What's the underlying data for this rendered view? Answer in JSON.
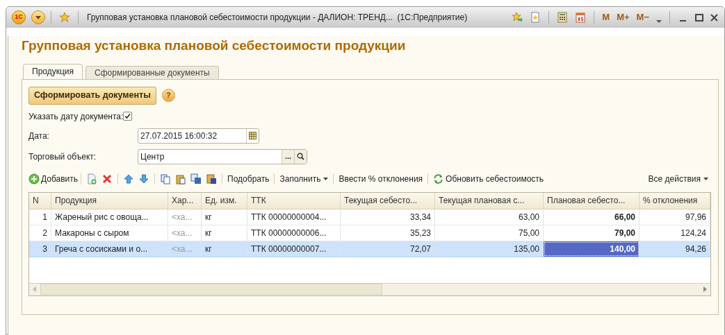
{
  "window": {
    "logo": "1С",
    "title": "Групповая установка плановой себестоимости продукции - ДАЛИОН: ТРЕНД...  (1С:Предприятие)",
    "memory_buttons": [
      "M",
      "M+",
      "M−"
    ]
  },
  "form_title": "Групповая установка плановой себестоимости продукции",
  "tabs": [
    {
      "label": "Продукция",
      "selected": true
    },
    {
      "label": "Сформированные документы",
      "selected": false
    }
  ],
  "primary_button": "Сформировать документы",
  "help_button": "?",
  "set_date": {
    "label": "Указать дату документа:",
    "checked": true
  },
  "date": {
    "label": "Дата:",
    "value": "27.07.2015 16:00:32"
  },
  "outlet": {
    "label": "Торговый объект:",
    "value": "Центр",
    "choose": "..."
  },
  "toolbar": {
    "add": "Добавить",
    "pick": "Подобрать",
    "fill": "Заполнить",
    "deviation": "Ввести % отклонения",
    "refresh": "Обновить себестоимость",
    "all_actions": "Все действия"
  },
  "table": {
    "columns": [
      {
        "title": "N",
        "kind": "number"
      },
      {
        "title": "Продукция",
        "kind": "text"
      },
      {
        "title": "Хар...",
        "kind": "muted"
      },
      {
        "title": "Ед. изм.",
        "kind": "text"
      },
      {
        "title": "ТТК",
        "kind": "text"
      },
      {
        "title": "Текущая себесто...",
        "kind": "number"
      },
      {
        "title": "Текущая плановая с...",
        "kind": "number"
      },
      {
        "title": "Плановая себесто...",
        "kind": "bold"
      },
      {
        "title": "% отклонения",
        "kind": "number"
      }
    ],
    "rows": [
      {
        "selected": false,
        "cells": [
          {
            "text": "1",
            "focused": false
          },
          {
            "text": "Жареный рис с овоща...",
            "focused": false
          },
          {
            "text": "<ха...",
            "focused": false
          },
          {
            "text": "кг",
            "focused": false
          },
          {
            "text": "ТТК 00000000004...",
            "focused": false
          },
          {
            "text": "33,34",
            "focused": false
          },
          {
            "text": "63,00",
            "focused": false
          },
          {
            "text": "66,00",
            "focused": false
          },
          {
            "text": "97,96",
            "focused": false
          }
        ]
      },
      {
        "selected": false,
        "cells": [
          {
            "text": "2",
            "focused": false
          },
          {
            "text": "Макароны с сыром",
            "focused": false
          },
          {
            "text": "<ха...",
            "focused": false
          },
          {
            "text": "кг",
            "focused": false
          },
          {
            "text": "ТТК 00000000006...",
            "focused": false
          },
          {
            "text": "35,23",
            "focused": false
          },
          {
            "text": "75,00",
            "focused": false
          },
          {
            "text": "79,00",
            "focused": false
          },
          {
            "text": "124,24",
            "focused": false
          }
        ]
      },
      {
        "selected": true,
        "cells": [
          {
            "text": "3",
            "focused": false
          },
          {
            "text": "Греча с сосисками и о...",
            "focused": false
          },
          {
            "text": "<ха...",
            "focused": false
          },
          {
            "text": "кг",
            "focused": false
          },
          {
            "text": "ТТК 00000000007...",
            "focused": false
          },
          {
            "text": "72,07",
            "focused": false
          },
          {
            "text": "135,00",
            "focused": false
          },
          {
            "text": "140,00",
            "focused": true
          },
          {
            "text": "94,26",
            "focused": false
          }
        ]
      }
    ]
  }
}
